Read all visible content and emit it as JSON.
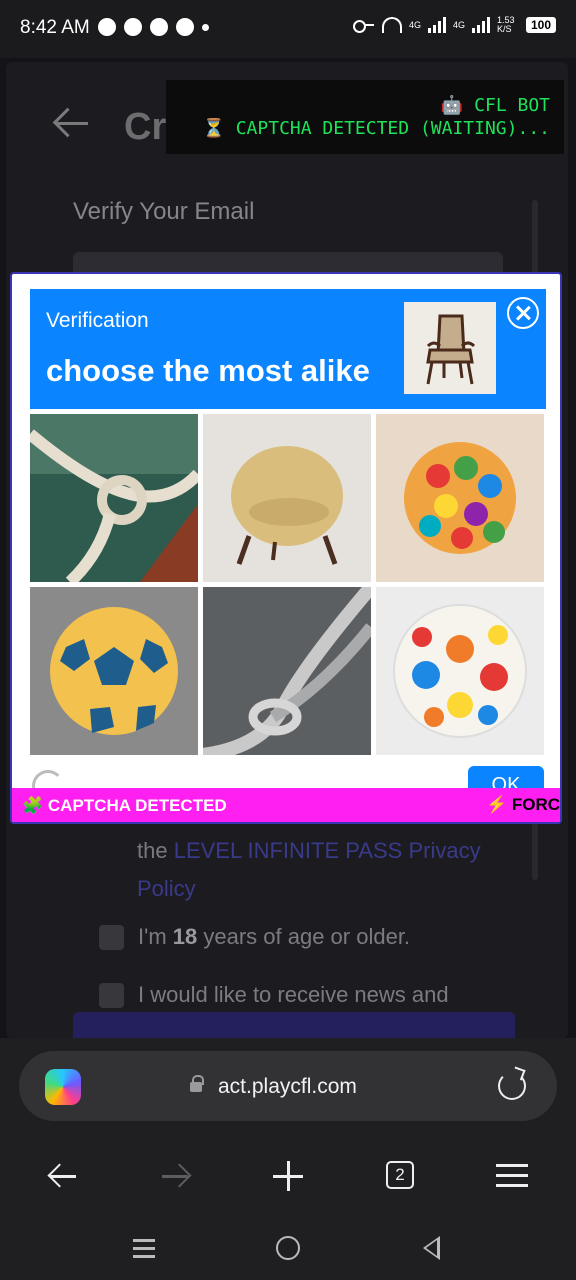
{
  "status_bar": {
    "time": "8:42 AM",
    "network_label_1": "4G",
    "network_label_2": "4G",
    "speed": "1.53 K/S",
    "battery": "100"
  },
  "page": {
    "title": "Create New",
    "subtitle": "Verify Your Email",
    "policy_prefix": "the ",
    "policy_link": "LEVEL INFINITE PASS Privacy Policy",
    "age_label_pre": "I'm ",
    "age_label_bold": "18",
    "age_label_post": " years of age or older.",
    "news_label": "I would like to receive news and"
  },
  "bot_overlay": {
    "line1": "🤖 CFL BOT",
    "line2": "⏳ CAPTCHA DETECTED (WAITING)..."
  },
  "captcha": {
    "header_label": "Verification",
    "instruction": "choose the most alike",
    "reference_image": "armchair",
    "tiles": [
      "rope-knot-boat",
      "beige-egg-chair",
      "colorful-ball-cluster",
      "yellow-blue-soccer-ball",
      "grey-rope-knot",
      "colorful-soccer-ball"
    ],
    "ok_label": "OK",
    "banner_left": "🧩 CAPTCHA DETECTED",
    "banner_right": "⚡ FORC"
  },
  "browser": {
    "url": "act.playcfl.com",
    "tab_count": "2"
  },
  "colors": {
    "captcha_blue": "#0a84ff",
    "banner_magenta": "#ff1ff0",
    "bot_green": "#1fe25a"
  }
}
